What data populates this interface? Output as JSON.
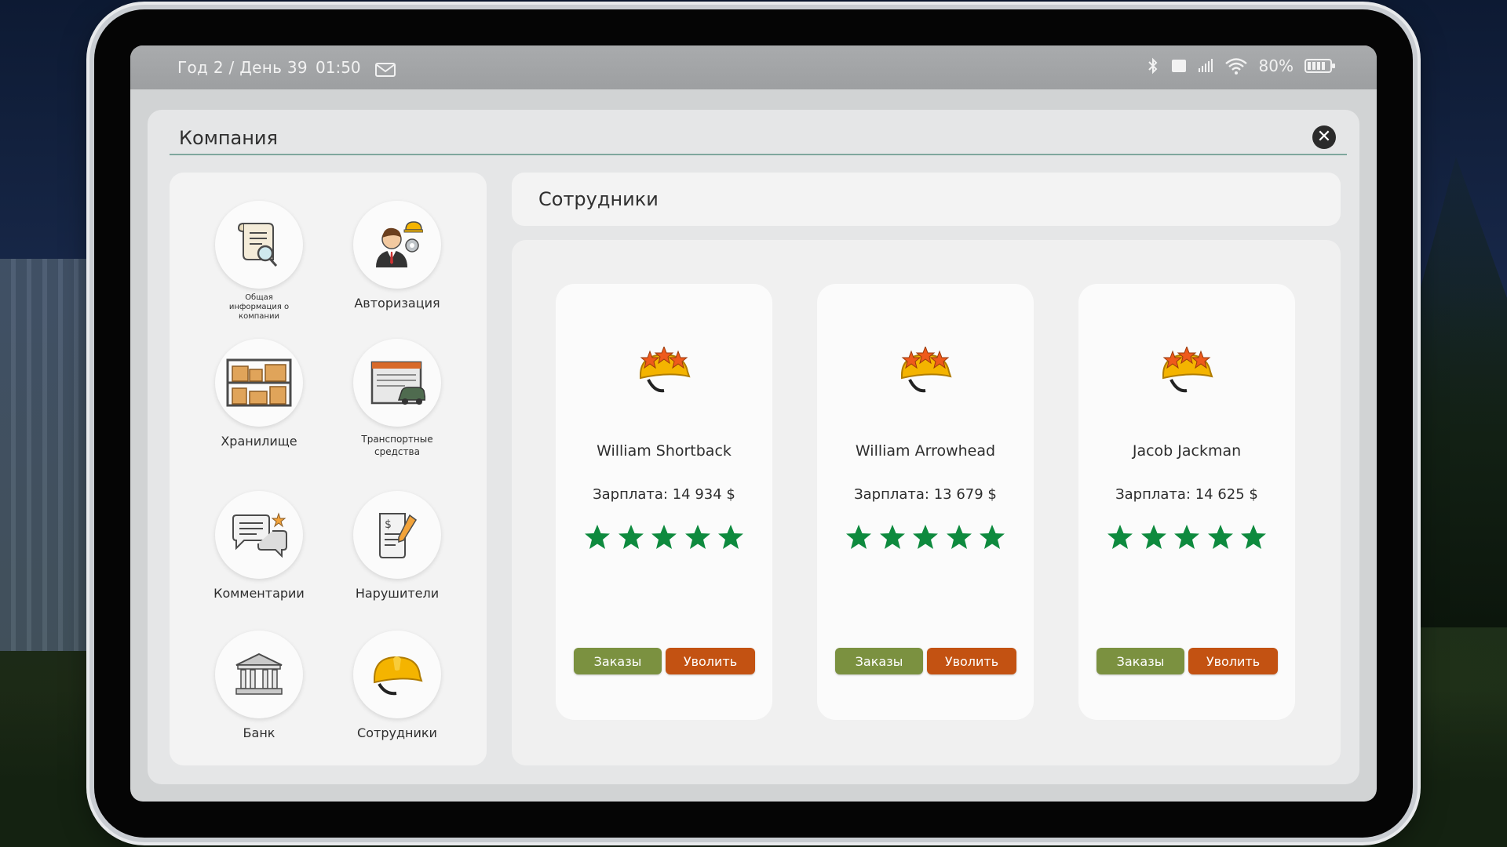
{
  "status_bar": {
    "date": "Год 2 / День 39",
    "time": "01:50",
    "battery": "80%",
    "icons": [
      "mail-icon",
      "bluetooth-icon",
      "sim-icon",
      "signal-icon",
      "wifi-icon",
      "battery-icon"
    ]
  },
  "panel": {
    "title": "Компания",
    "close_icon": "close-icon"
  },
  "sidebar": {
    "items": [
      {
        "label": "Общая информация о компании",
        "icon": "document-search-icon"
      },
      {
        "label": "Авторизация",
        "icon": "authorization-person-icon"
      },
      {
        "label": "Хранилище",
        "icon": "storage-shelves-icon"
      },
      {
        "label": "Транспортные средства",
        "icon": "garage-vehicle-icon"
      },
      {
        "label": "Комментарии",
        "icon": "comments-icon"
      },
      {
        "label": "Нарушители",
        "icon": "violators-invoice-icon"
      },
      {
        "label": "Банк",
        "icon": "bank-icon"
      },
      {
        "label": "Сотрудники",
        "icon": "hard-hat-icon"
      }
    ]
  },
  "section": {
    "title": "Сотрудники"
  },
  "employees": [
    {
      "name": "William Shortback",
      "salary": "Зарплата: 14 934 $",
      "stars": 5,
      "orders_label": "Заказы",
      "fire_label": "Уволить"
    },
    {
      "name": "William Arrowhead",
      "salary": "Зарплата: 13 679 $",
      "stars": 5,
      "orders_label": "Заказы",
      "fire_label": "Уволить"
    },
    {
      "name": "Jacob Jackman",
      "salary": "Зарплата: 14 625 $",
      "stars": 5,
      "orders_label": "Заказы",
      "fire_label": "Уволить"
    }
  ],
  "colors": {
    "orders_button": "#7b9140",
    "fire_button": "#c35212",
    "star": "#0e8a3e",
    "title_underline": "#7fa79d"
  }
}
